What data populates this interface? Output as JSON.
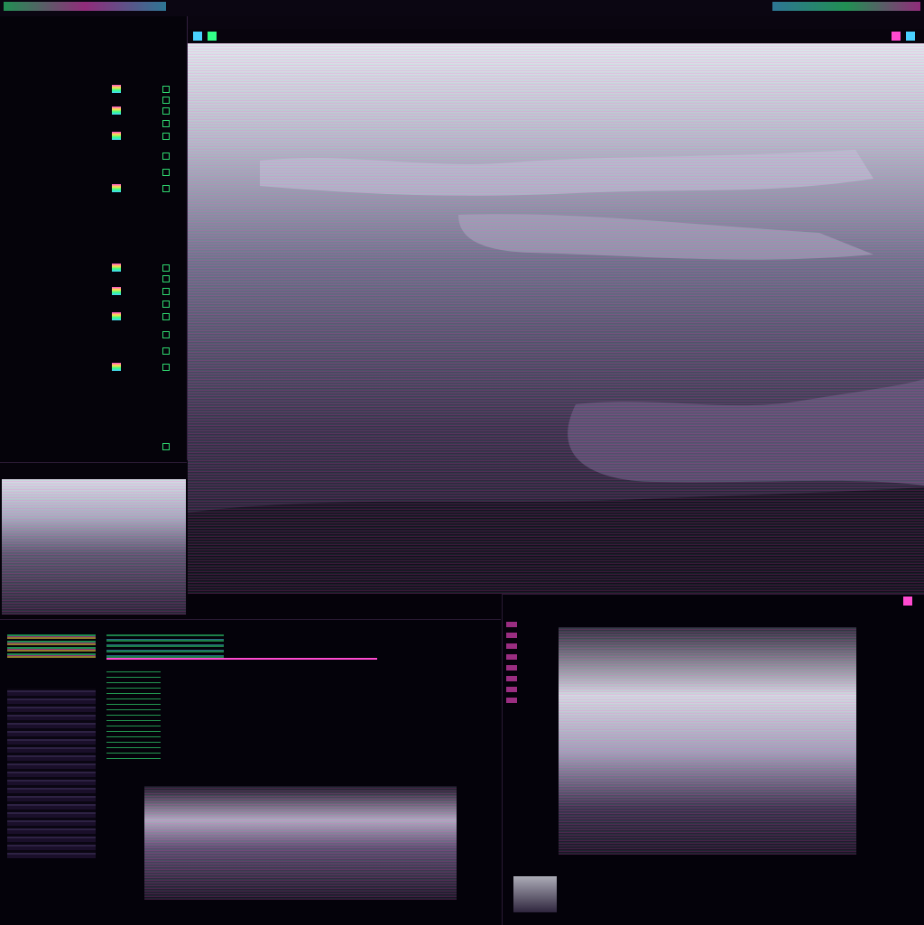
{
  "topbar": {
    "title": ""
  },
  "menubar": {
    "items": [
      "",
      "",
      "",
      "",
      "",
      "",
      "",
      "",
      ""
    ]
  },
  "toolbar": {
    "summary": ""
  },
  "left_panel": {
    "groups": [
      {
        "title": "",
        "rows": [
          "",
          "",
          "",
          "",
          "",
          "",
          "",
          "",
          "",
          "",
          "",
          ""
        ]
      },
      {
        "title": "",
        "rows": [
          "",
          "",
          "",
          "",
          "",
          "",
          "",
          "",
          "",
          "",
          "",
          ""
        ]
      },
      {
        "title": "",
        "rows": [
          "",
          "",
          "",
          "",
          "",
          ""
        ]
      }
    ]
  },
  "preview": {
    "title": ""
  },
  "editor": {
    "tab1": "",
    "tab2": "",
    "status": ""
  },
  "viewer": {
    "title": "",
    "status": ""
  },
  "colors": {
    "accent_green": "#33ff88",
    "accent_magenta": "#ff4ad0",
    "accent_cyan": "#4ad2ff",
    "background": "#05020a"
  },
  "icons": [
    "gear-icon",
    "close-icon",
    "folder-icon",
    "checkbox-icon",
    "color-swatch-icon"
  ]
}
